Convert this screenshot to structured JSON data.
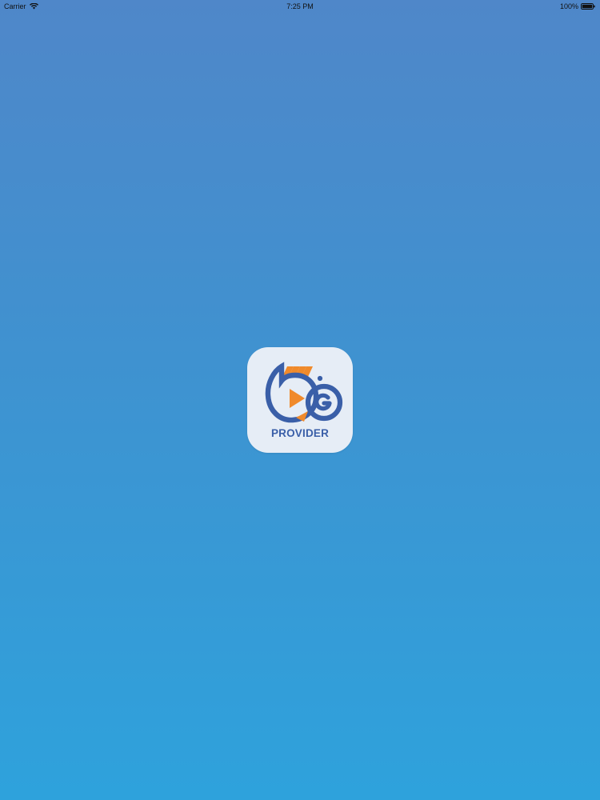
{
  "status_bar": {
    "carrier": "Carrier",
    "time": "7:25 PM",
    "battery": "100%",
    "icons": [
      "wifi-icon",
      "battery-icon"
    ]
  },
  "app_icon": {
    "name": "PROVIDER",
    "colors": {
      "background": "#e6edf6",
      "primary_blue": "#3a5fa8",
      "accent_orange": "#f08a2b"
    }
  },
  "screen": {
    "gradient_top": "#4f87c9",
    "gradient_bottom": "#2ea2dc"
  }
}
